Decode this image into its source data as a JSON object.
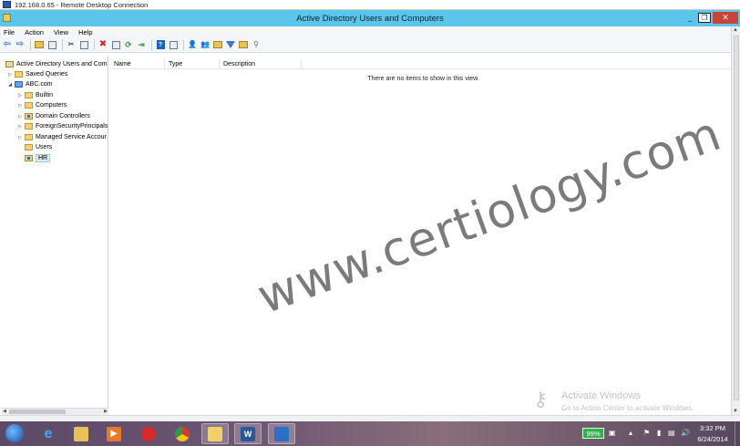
{
  "rdp": {
    "title": "192.168.0.65 - Remote Desktop Connection"
  },
  "window": {
    "title": "Active Directory Users and Computers"
  },
  "window_controls": {
    "minimize": "_",
    "maximize": "❐",
    "close": "✕"
  },
  "menu": {
    "items": [
      "File",
      "Action",
      "View",
      "Help"
    ]
  },
  "tree": {
    "items": [
      {
        "label": "Active Directory Users and Com",
        "icon": "ad-root-icon",
        "expander": ""
      },
      {
        "label": "Saved Queries",
        "icon": "folder-icon",
        "expander": "▷"
      },
      {
        "label": "ABC.com",
        "icon": "domain-icon",
        "expander": "◢"
      },
      {
        "label": "Builtin",
        "icon": "folder-icon",
        "expander": "▷"
      },
      {
        "label": "Computers",
        "icon": "folder-icon",
        "expander": "▷"
      },
      {
        "label": "Domain Controllers",
        "icon": "ou-icon",
        "expander": "▷"
      },
      {
        "label": "ForeignSecurityPrincipals",
        "icon": "folder-icon",
        "expander": "▷"
      },
      {
        "label": "Managed Service Accour",
        "icon": "folder-icon",
        "expander": "▷"
      },
      {
        "label": "Users",
        "icon": "folder-icon",
        "expander": ""
      },
      {
        "label": "HR",
        "icon": "ou-icon",
        "expander": ""
      }
    ],
    "selected": "HR"
  },
  "details": {
    "columns": [
      "Name",
      "Type",
      "Description"
    ],
    "empty_message": "There are no items to show in this view."
  },
  "watermark": {
    "text": "www.certiology.com"
  },
  "activation": {
    "line1": "Activate Windows",
    "line2": "Go to Action Center to activate Windows."
  },
  "taskbar": {
    "battery": "99%",
    "time": "3:32 PM",
    "date": "6/24/2014",
    "apps": [
      "internet-explorer-icon",
      "file-explorer-icon",
      "media-player-icon",
      "pdf-reader-icon",
      "chrome-icon",
      "folder-icon",
      "word-icon",
      "remote-desktop-icon"
    ],
    "word_glyph": "W"
  }
}
